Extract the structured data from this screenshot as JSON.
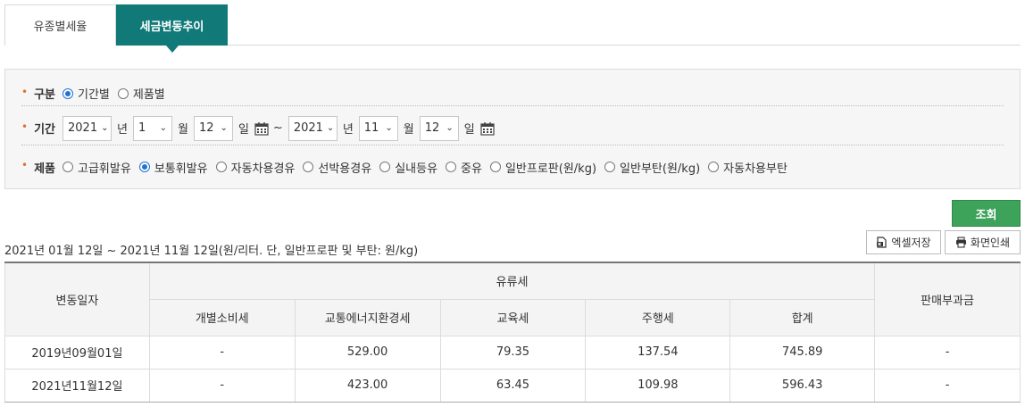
{
  "tabs": [
    {
      "label": "유종별세율",
      "active": false
    },
    {
      "label": "세금변동추이",
      "active": true
    }
  ],
  "filter": {
    "category": {
      "label": "구분",
      "options": [
        {
          "label": "기간별",
          "checked": true
        },
        {
          "label": "제품별",
          "checked": false
        }
      ]
    },
    "period": {
      "label": "기간",
      "start": {
        "year": "2021",
        "month": "1",
        "day": "12"
      },
      "end": {
        "year": "2021",
        "month": "11",
        "day": "12"
      },
      "unit_year": "년",
      "unit_month": "월",
      "unit_day": "일",
      "separator": "~"
    },
    "product": {
      "label": "제품",
      "options": [
        {
          "label": "고급휘발유",
          "checked": false
        },
        {
          "label": "보통휘발유",
          "checked": true
        },
        {
          "label": "자동차용경유",
          "checked": false
        },
        {
          "label": "선박용경유",
          "checked": false
        },
        {
          "label": "실내등유",
          "checked": false
        },
        {
          "label": "중유",
          "checked": false
        },
        {
          "label": "일반프로판(원/kg)",
          "checked": false
        },
        {
          "label": "일반부탄(원/kg)",
          "checked": false
        },
        {
          "label": "자동차용부탄",
          "checked": false
        }
      ]
    }
  },
  "search_button": "조회",
  "period_text": "2021년 01월 12일 ~ 2021년 11월 12일(원/리터. 단, 일반프로판 및 부탄: 원/kg)",
  "excel_button": "엑셀저장",
  "print_button": "화면인쇄",
  "table": {
    "h_date": "변동일자",
    "h_group": "유류세",
    "h_sub": [
      "개별소비세",
      "교통에너지환경세",
      "교육세",
      "주행세",
      "합계"
    ],
    "h_surcharge": "판매부과금",
    "rows": [
      [
        "2019년09월01일",
        "-",
        "529.00",
        "79.35",
        "137.54",
        "745.89",
        "-"
      ],
      [
        "2021년11월12일",
        "-",
        "423.00",
        "63.45",
        "109.98",
        "596.43",
        "-"
      ]
    ]
  },
  "colors": {
    "tab_active": "#117a78",
    "search_button": "#3da35a",
    "radio_checked": "#1e73d2",
    "bullet": "#e0712c"
  }
}
